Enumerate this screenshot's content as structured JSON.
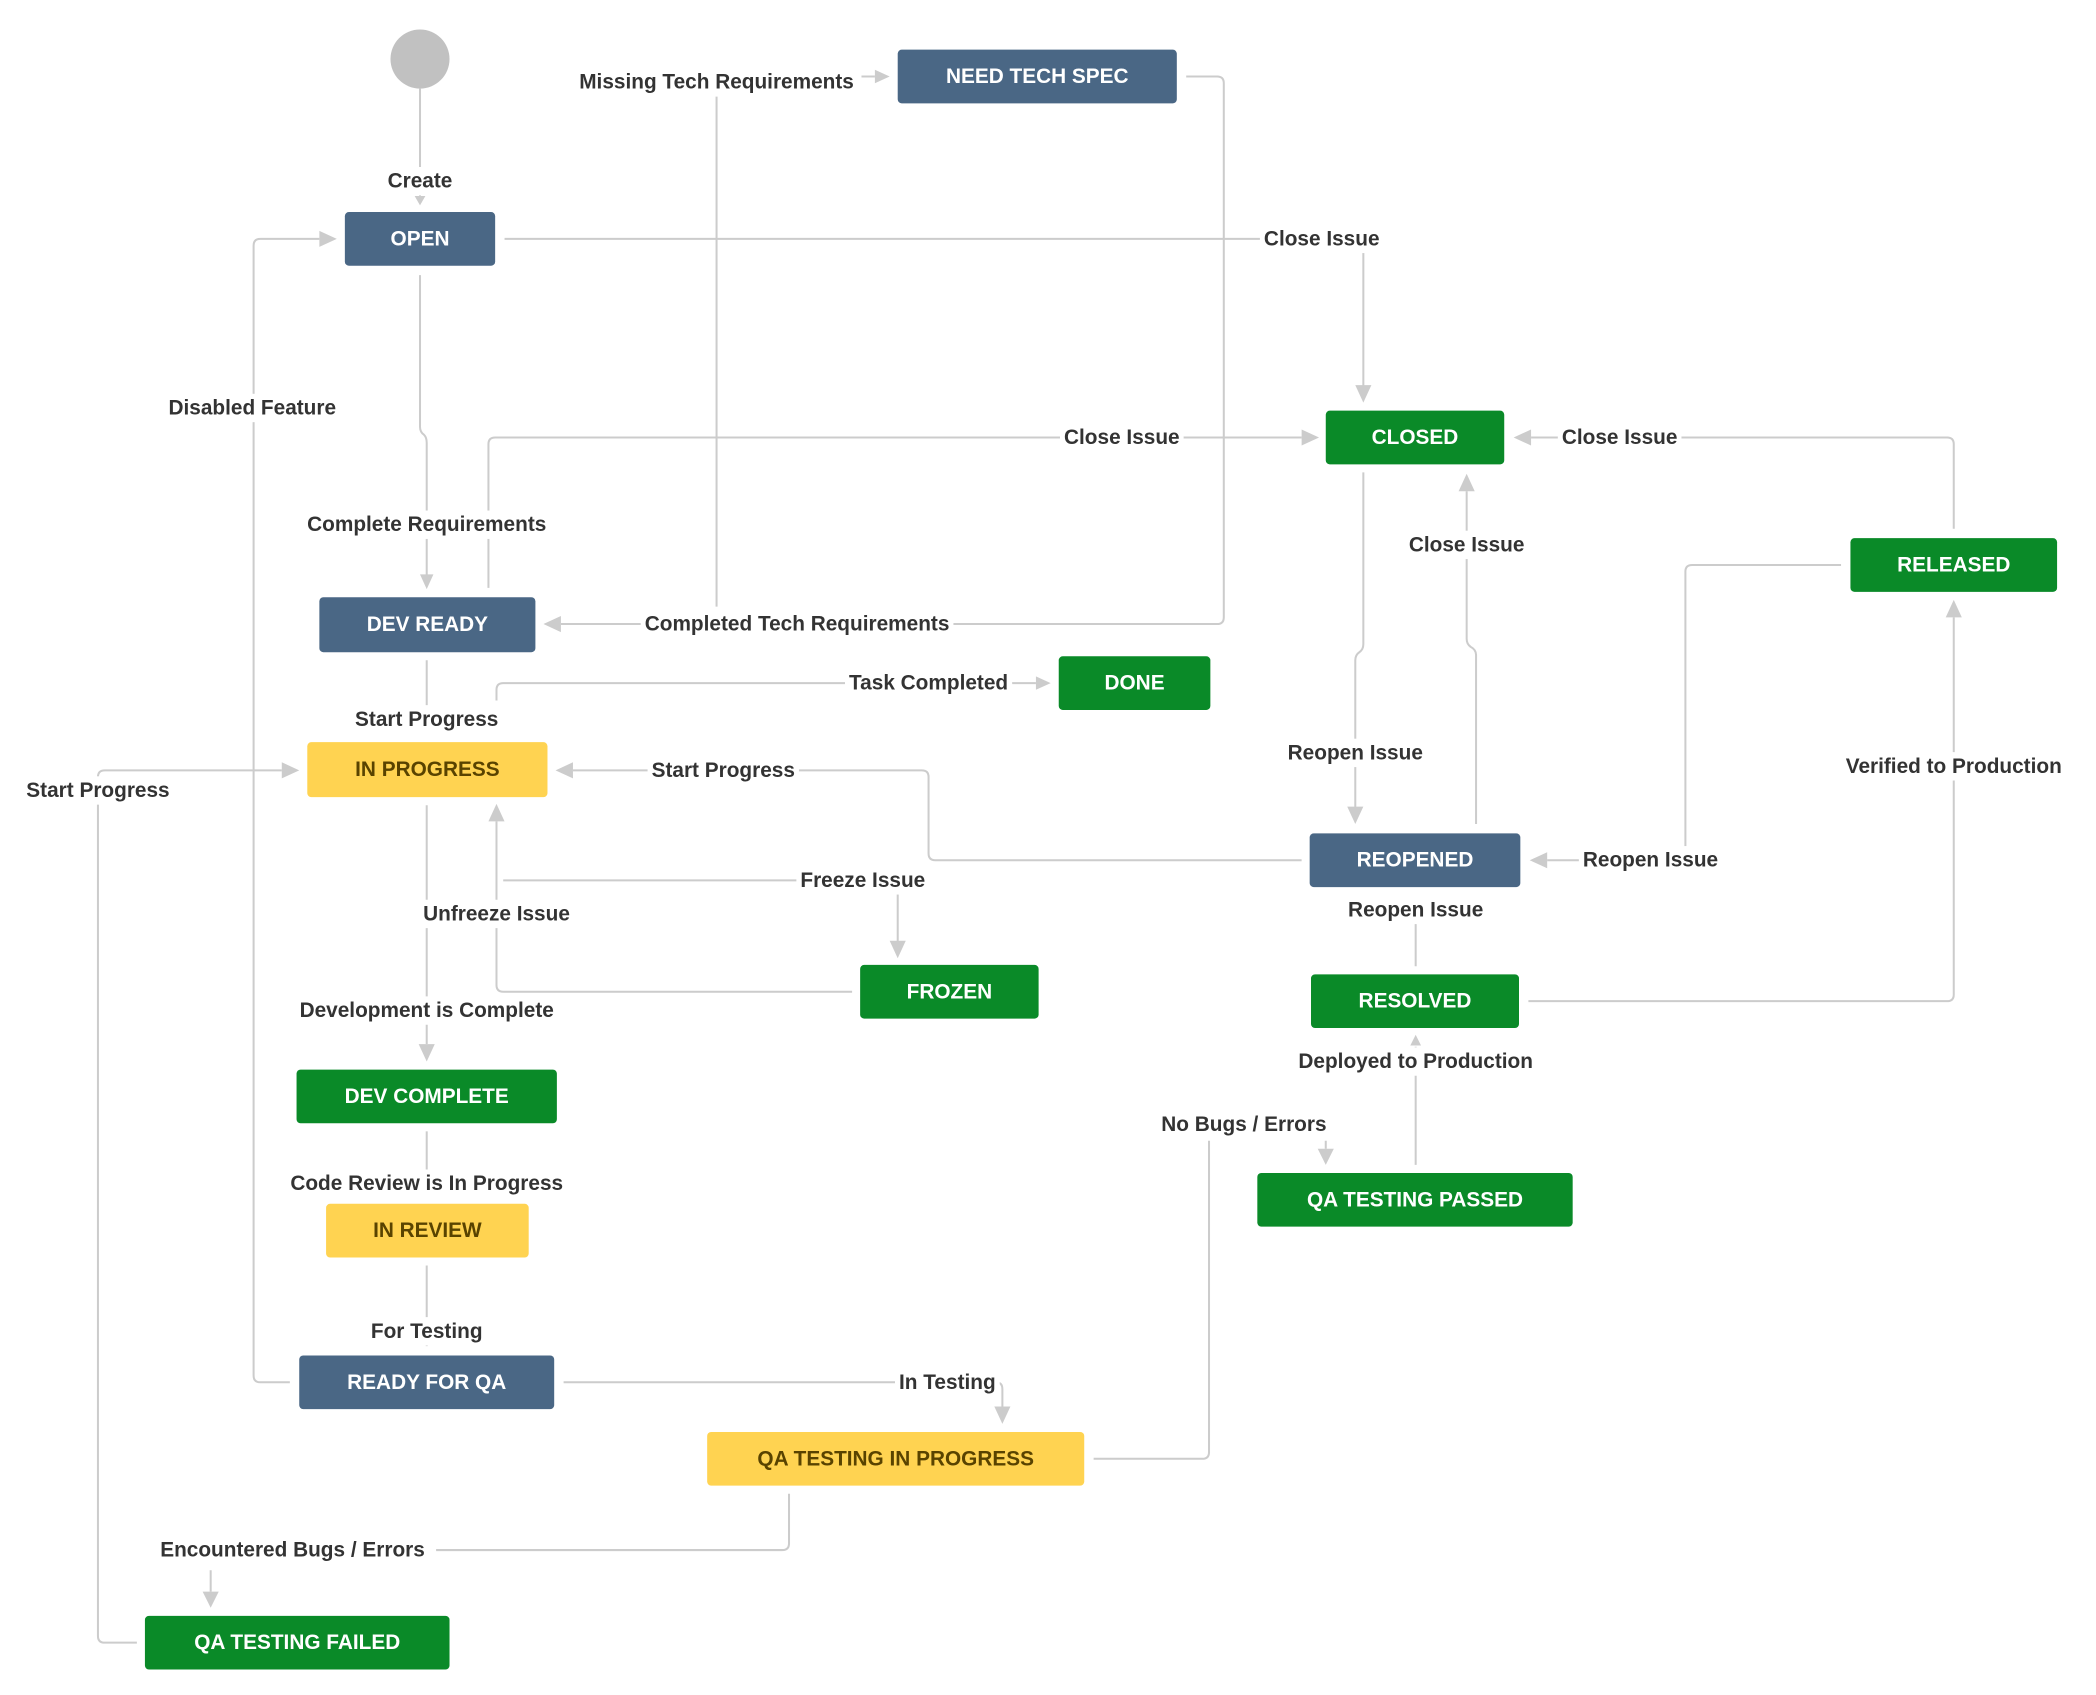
{
  "colors": {
    "todo": "#4a6785",
    "todo_text": "#ffffff",
    "inprogress": "#ffd351",
    "inprogress_text": "#594300",
    "done": "#0a8a28",
    "done_text": "#ffffff",
    "start": "#c1c1c1",
    "line": "#cccccc",
    "label": "#333333"
  },
  "statuses": {
    "open": {
      "label": "OPEN",
      "category": "todo"
    },
    "need_tech_spec": {
      "label": "NEED TECH SPEC",
      "category": "todo"
    },
    "closed": {
      "label": "CLOSED",
      "category": "done"
    },
    "released": {
      "label": "RELEASED",
      "category": "done"
    },
    "dev_ready": {
      "label": "DEV READY",
      "category": "todo"
    },
    "done": {
      "label": "DONE",
      "category": "done"
    },
    "in_progress": {
      "label": "IN PROGRESS",
      "category": "inprogress"
    },
    "reopened": {
      "label": "REOPENED",
      "category": "todo"
    },
    "frozen": {
      "label": "FROZEN",
      "category": "done"
    },
    "resolved": {
      "label": "RESOLVED",
      "category": "done"
    },
    "dev_complete": {
      "label": "DEV COMPLETE",
      "category": "done"
    },
    "qa_testing_passed": {
      "label": "QA TESTING PASSED",
      "category": "done"
    },
    "in_review": {
      "label": "IN REVIEW",
      "category": "inprogress"
    },
    "ready_for_qa": {
      "label": "READY FOR QA",
      "category": "todo"
    },
    "qa_testing_in_progress": {
      "label": "QA TESTING IN PROGRESS",
      "category": "inprogress"
    },
    "qa_testing_failed": {
      "label": "QA TESTING FAILED",
      "category": "done"
    }
  },
  "transitions": {
    "create": {
      "label": "Create",
      "from": "start",
      "to": "open"
    },
    "complete_requirements": {
      "label": "Complete Requirements",
      "from": "open",
      "to": "dev_ready"
    },
    "missing_tech_requirements": {
      "label": "Missing Tech Requirements",
      "from": "dev_ready",
      "to": "need_tech_spec"
    },
    "completed_tech_requirements": {
      "label": "Completed Tech Requirements",
      "from": "need_tech_spec",
      "to": "dev_ready"
    },
    "close_issue_open": {
      "label": "Close Issue",
      "from": "open",
      "to": "closed"
    },
    "close_issue_dev_ready": {
      "label": "Close Issue",
      "from": "dev_ready",
      "to": "closed"
    },
    "close_issue_released": {
      "label": "Close Issue",
      "from": "released",
      "to": "closed"
    },
    "close_issue_reopened": {
      "label": "Close Issue",
      "from": "reopened",
      "to": "closed"
    },
    "reopen_issue_closed": {
      "label": "Reopen Issue",
      "from": "closed",
      "to": "reopened"
    },
    "reopen_issue_released": {
      "label": "Reopen Issue",
      "from": "released",
      "to": "reopened"
    },
    "reopen_issue_resolved": {
      "label": "Reopen Issue",
      "from": "resolved",
      "to": "reopened"
    },
    "disabled_feature": {
      "label": "Disabled Feature",
      "from": "ready_for_qa",
      "to": "open"
    },
    "start_progress_dev_ready": {
      "label": "Start Progress",
      "from": "dev_ready",
      "to": "in_progress"
    },
    "start_progress_reopened": {
      "label": "Start Progress",
      "from": "reopened",
      "to": "in_progress"
    },
    "start_progress_failed": {
      "label": "Start Progress",
      "from": "qa_testing_failed",
      "to": "in_progress"
    },
    "task_completed": {
      "label": "Task Completed",
      "from": "in_progress",
      "to": "done"
    },
    "freeze_issue": {
      "label": "Freeze Issue",
      "from": "in_progress",
      "to": "frozen"
    },
    "unfreeze_issue": {
      "label": "Unfreeze Issue",
      "from": "frozen",
      "to": "in_progress"
    },
    "development_is_complete": {
      "label": "Development is Complete",
      "from": "in_progress",
      "to": "dev_complete"
    },
    "code_review_in_progress": {
      "label": "Code Review is In Progress",
      "from": "dev_complete",
      "to": "in_review"
    },
    "for_testing": {
      "label": "For Testing",
      "from": "in_review",
      "to": "ready_for_qa"
    },
    "in_testing": {
      "label": "In Testing",
      "from": "ready_for_qa",
      "to": "qa_testing_in_progress"
    },
    "no_bugs_errors": {
      "label": "No Bugs / Errors",
      "from": "qa_testing_in_progress",
      "to": "qa_testing_passed"
    },
    "encountered_bugs_errors": {
      "label": "Encountered Bugs / Errors",
      "from": "qa_testing_in_progress",
      "to": "qa_testing_failed"
    },
    "deployed_to_production": {
      "label": "Deployed to Production",
      "from": "qa_testing_passed",
      "to": "resolved"
    },
    "verified_to_production": {
      "label": "Verified to Production",
      "from": "resolved",
      "to": "released"
    }
  }
}
